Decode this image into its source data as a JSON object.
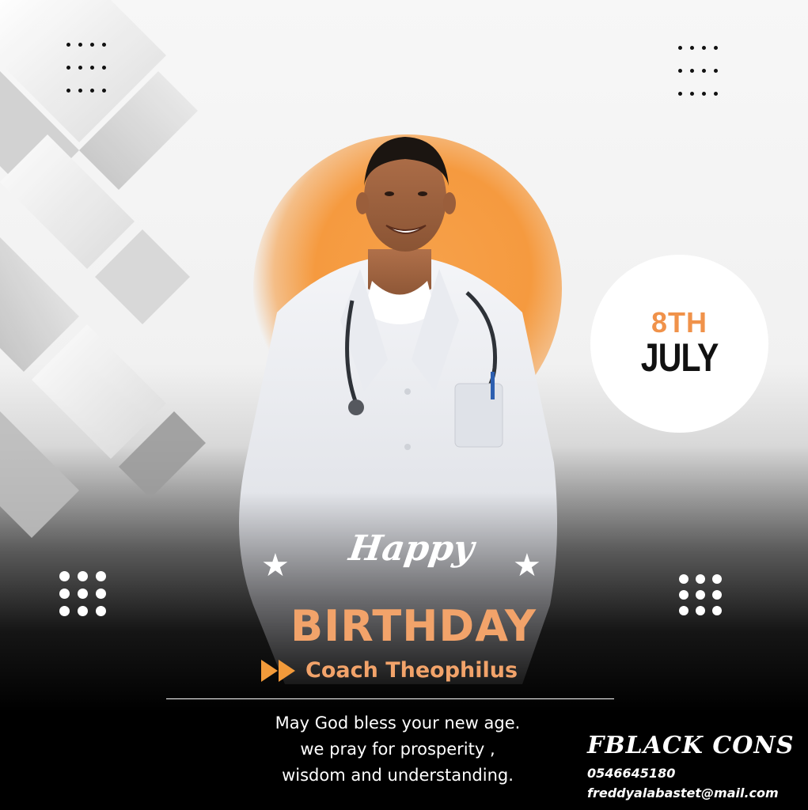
{
  "date": {
    "day": "8TH",
    "month": "JULY"
  },
  "greeting": {
    "happy": "Happy",
    "birthday": "BIRTHDAY",
    "name": "Coach Theophilus"
  },
  "message": {
    "lines": [
      "May God bless your new age.",
      "we pray for prosperity ,",
      "wisdom and understanding."
    ]
  },
  "contact": {
    "brand": "FBLACK CONS",
    "phone": "0546645180",
    "email": "freddyalabastet@mail.com"
  },
  "icons": {
    "decorations": [
      "star-icon",
      "fast-forward-icon",
      "dot-grid-icon"
    ]
  },
  "colors": {
    "accent": "#f2a36a",
    "orange_glow": "#f59a3f",
    "background_dark": "#000000",
    "text_light": "#ffffff"
  }
}
